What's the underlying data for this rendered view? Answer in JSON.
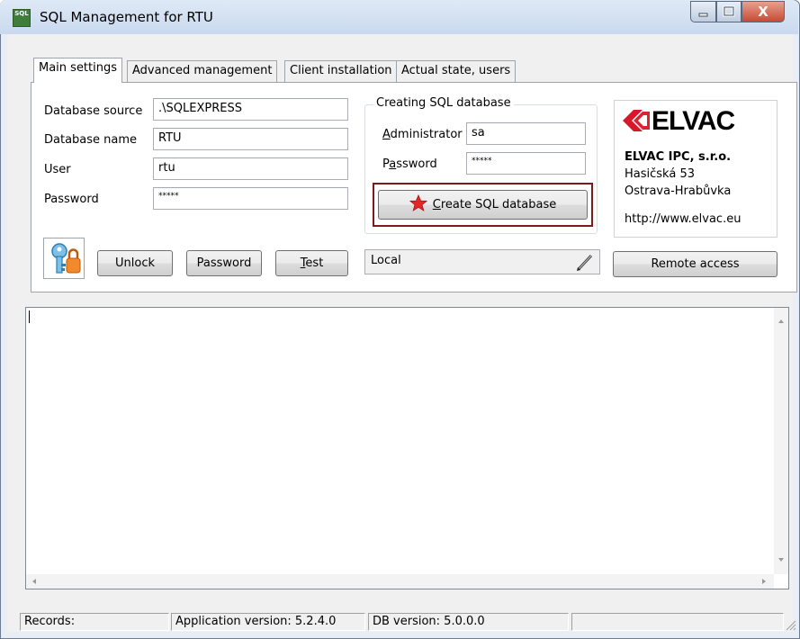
{
  "window": {
    "title": "SQL Management for RTU",
    "app_icon_text": "SQL",
    "close_glyph": "X"
  },
  "tabs": [
    {
      "label": "Main settings",
      "active": true
    },
    {
      "label": "Advanced management",
      "active": false
    },
    {
      "label": "Client installation",
      "active": false
    },
    {
      "label": "Actual state, users",
      "active": false
    }
  ],
  "connection": {
    "source_label": "Database source",
    "source_value": ".\\SQLEXPRESS",
    "name_label": "Database name",
    "name_value": "RTU",
    "user_label": "User",
    "user_value": "rtu",
    "password_label": "Password",
    "password_value": "*****"
  },
  "create_group": {
    "title": "Creating SQL database",
    "admin_label_u": "A",
    "admin_label_rest": "dministrator",
    "admin_value": "sa",
    "password_label_pre": "P",
    "password_label_u": "a",
    "password_label_rest": "ssword",
    "password_value": "*****",
    "create_button_u": "C",
    "create_button_rest": "reate SQL database"
  },
  "logo": {
    "brand": "ELVAC",
    "company": "ELVAC IPC, s.r.o.",
    "street": "Hasičská 53",
    "city": "Ostrava-Hrabůvka",
    "url": "http://www.elvac.eu"
  },
  "buttons": {
    "unlock": "Unlock",
    "password": "Password",
    "test_u": "T",
    "test_rest": "est",
    "remote_access": "Remote access"
  },
  "local_field": {
    "value": "Local"
  },
  "status_bar": {
    "records": "Records:",
    "app_version": "Application version: 5.2.4.0",
    "db_version": "DB version: 5.0.0.0"
  },
  "icons": {
    "key": "key-icon",
    "star": "star-icon",
    "pencil": "pencil-icon",
    "resize": "resize-grip-icon"
  },
  "colors": {
    "highlight_border": "#7d1a1a",
    "brand_red": "#d7182a",
    "star": "#e32626"
  }
}
